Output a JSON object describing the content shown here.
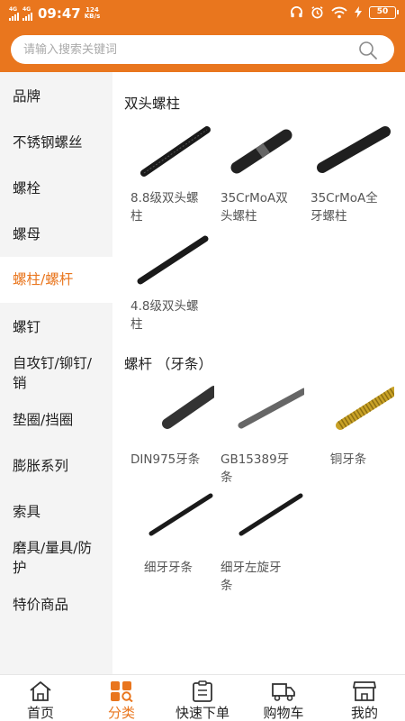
{
  "status_bar": {
    "net1": "4G",
    "net2": "4G",
    "time": "09:47",
    "speed_value": "124",
    "speed_unit": "KB/s",
    "battery": "50"
  },
  "search": {
    "placeholder": "请输入搜索关键词",
    "value": ""
  },
  "sidebar": {
    "items": [
      {
        "label": "品牌"
      },
      {
        "label": "不锈钢螺丝"
      },
      {
        "label": "螺栓"
      },
      {
        "label": "螺母"
      },
      {
        "label": "螺柱/螺杆"
      },
      {
        "label": "螺钉"
      },
      {
        "label_line1": "自攻钉/铆钉/",
        "label_line2": "销"
      },
      {
        "label": "垫圈/挡圈"
      },
      {
        "label": "膨胀系列"
      },
      {
        "label": "索具"
      },
      {
        "label_line1": "磨具/量具/防",
        "label_line2": "护"
      },
      {
        "label": "特价商品"
      }
    ],
    "selected": "螺柱/螺杆"
  },
  "sections": [
    {
      "title": "双头螺柱",
      "products": [
        {
          "line1": "8.8级双头螺",
          "line2": "柱"
        },
        {
          "line1": "35CrMoA双",
          "line2": "头螺柱"
        },
        {
          "line1": "35CrMoA全",
          "line2": "牙螺柱"
        },
        {
          "line1": "4.8级双头螺",
          "line2": "柱"
        }
      ]
    },
    {
      "title": "螺杆 （牙条）",
      "products": [
        {
          "line1": "DIN975牙条",
          "line2": ""
        },
        {
          "line1": "GB15389牙",
          "line2": "条"
        },
        {
          "line1": "铜牙条",
          "line2": ""
        },
        {
          "line1": "细牙牙条",
          "line2": ""
        },
        {
          "line1": "细牙左旋牙",
          "line2": "条"
        }
      ]
    }
  ],
  "tabbar": {
    "tabs": [
      {
        "label": "首页"
      },
      {
        "label": "分类"
      },
      {
        "label": "快速下单"
      },
      {
        "label": "购物车"
      },
      {
        "label": "我的"
      }
    ],
    "active": "分类"
  },
  "colors": {
    "brand": "#e9761e",
    "sidebar_bg": "#f4f4f4"
  }
}
